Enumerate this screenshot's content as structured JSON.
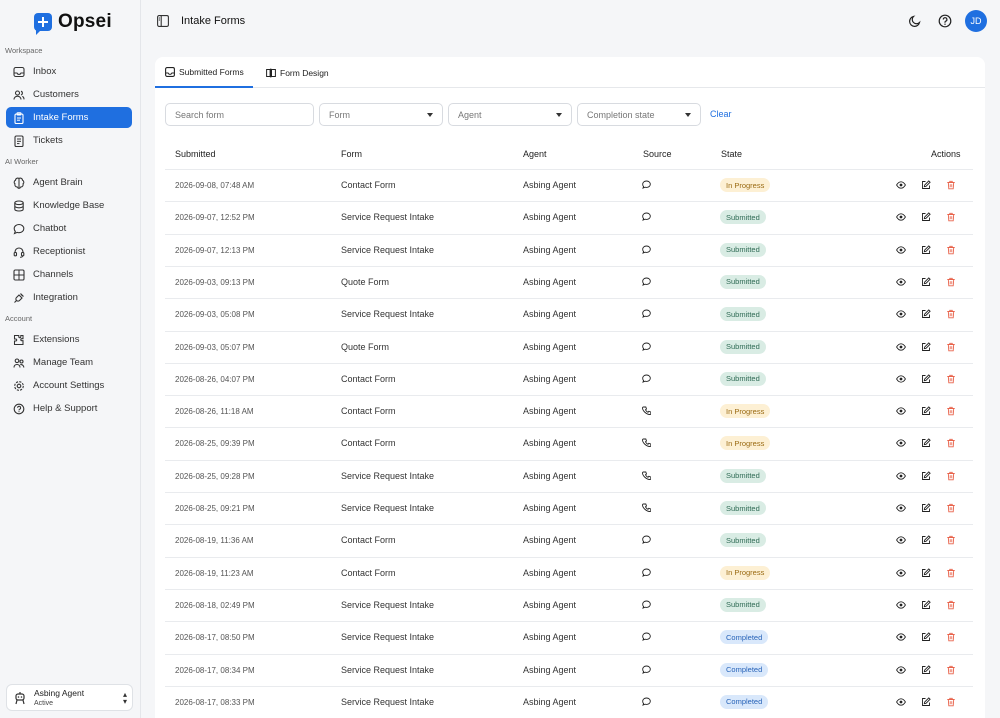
{
  "app": {
    "name": "Opsei"
  },
  "sidebar": {
    "sections": [
      {
        "label": "Workspace",
        "items": [
          {
            "label": "Inbox",
            "icon": "inbox-icon"
          },
          {
            "label": "Customers",
            "icon": "users-icon"
          },
          {
            "label": "Intake Forms",
            "icon": "clipboard-icon",
            "active": true
          },
          {
            "label": "Tickets",
            "icon": "ticket-icon"
          }
        ]
      },
      {
        "label": "AI Worker",
        "items": [
          {
            "label": "Agent Brain",
            "icon": "brain-icon"
          },
          {
            "label": "Knowledge Base",
            "icon": "database-icon"
          },
          {
            "label": "Chatbot",
            "icon": "chat-icon"
          },
          {
            "label": "Receptionist",
            "icon": "headset-icon"
          },
          {
            "label": "Channels",
            "icon": "grid-icon"
          },
          {
            "label": "Integration",
            "icon": "plug-icon"
          }
        ]
      },
      {
        "label": "Account",
        "items": [
          {
            "label": "Extensions",
            "icon": "extensions-icon"
          },
          {
            "label": "Manage Team",
            "icon": "team-icon"
          },
          {
            "label": "Account Settings",
            "icon": "gear-icon"
          },
          {
            "label": "Help & Support",
            "icon": "help-icon"
          }
        ]
      }
    ],
    "user": {
      "name": "Asbing Agent",
      "status": "Active"
    }
  },
  "header": {
    "title": "Intake Forms",
    "avatar_initials": "JD"
  },
  "tabs": [
    {
      "label": "Submitted Forms",
      "active": true
    },
    {
      "label": "Form Design",
      "active": false
    }
  ],
  "filters": {
    "search_placeholder": "Search form",
    "form_label": "Form",
    "agent_label": "Agent",
    "state_label": "Completion state",
    "clear_label": "Clear"
  },
  "table": {
    "columns": [
      "Submitted",
      "Form",
      "Agent",
      "Source",
      "State",
      "Actions"
    ],
    "rows": [
      {
        "submitted": "2026-09-08, 07:48 AM",
        "form": "Contact Form",
        "agent": "Asbing Agent",
        "source": "chat",
        "state": "In Progress"
      },
      {
        "submitted": "2026-09-07, 12:52 PM",
        "form": "Service Request Intake",
        "agent": "Asbing Agent",
        "source": "chat",
        "state": "Submitted"
      },
      {
        "submitted": "2026-09-07, 12:13 PM",
        "form": "Service Request Intake",
        "agent": "Asbing Agent",
        "source": "chat",
        "state": "Submitted"
      },
      {
        "submitted": "2026-09-03, 09:13 PM",
        "form": "Quote Form",
        "agent": "Asbing Agent",
        "source": "chat",
        "state": "Submitted"
      },
      {
        "submitted": "2026-09-03, 05:08 PM",
        "form": "Service Request Intake",
        "agent": "Asbing Agent",
        "source": "chat",
        "state": "Submitted"
      },
      {
        "submitted": "2026-09-03, 05:07 PM",
        "form": "Quote Form",
        "agent": "Asbing Agent",
        "source": "chat",
        "state": "Submitted"
      },
      {
        "submitted": "2026-08-26, 04:07 PM",
        "form": "Contact Form",
        "agent": "Asbing Agent",
        "source": "chat",
        "state": "Submitted"
      },
      {
        "submitted": "2026-08-26, 11:18 AM",
        "form": "Contact Form",
        "agent": "Asbing Agent",
        "source": "phone",
        "state": "In Progress"
      },
      {
        "submitted": "2026-08-25, 09:39 PM",
        "form": "Contact Form",
        "agent": "Asbing Agent",
        "source": "phone",
        "state": "In Progress"
      },
      {
        "submitted": "2026-08-25, 09:28 PM",
        "form": "Service Request Intake",
        "agent": "Asbing Agent",
        "source": "phone",
        "state": "Submitted"
      },
      {
        "submitted": "2026-08-25, 09:21 PM",
        "form": "Service Request Intake",
        "agent": "Asbing Agent",
        "source": "phone",
        "state": "Submitted"
      },
      {
        "submitted": "2026-08-19, 11:36 AM",
        "form": "Contact Form",
        "agent": "Asbing Agent",
        "source": "chat",
        "state": "Submitted"
      },
      {
        "submitted": "2026-08-19, 11:23 AM",
        "form": "Contact Form",
        "agent": "Asbing Agent",
        "source": "chat",
        "state": "In Progress"
      },
      {
        "submitted": "2026-08-18, 02:49 PM",
        "form": "Service Request Intake",
        "agent": "Asbing Agent",
        "source": "chat",
        "state": "Submitted"
      },
      {
        "submitted": "2026-08-17, 08:50 PM",
        "form": "Service Request Intake",
        "agent": "Asbing Agent",
        "source": "chat",
        "state": "Completed"
      },
      {
        "submitted": "2026-08-17, 08:34 PM",
        "form": "Service Request Intake",
        "agent": "Asbing Agent",
        "source": "chat",
        "state": "Completed"
      },
      {
        "submitted": "2026-08-17, 08:33 PM",
        "form": "Service Request Intake",
        "agent": "Asbing Agent",
        "source": "chat",
        "state": "Completed"
      }
    ]
  },
  "colors": {
    "accent": "#1f6fe0",
    "in_progress_bg": "#fdf0d4",
    "submitted_bg": "#d9ece4",
    "completed_bg": "#d9e8fb",
    "delete": "#e8624a"
  }
}
